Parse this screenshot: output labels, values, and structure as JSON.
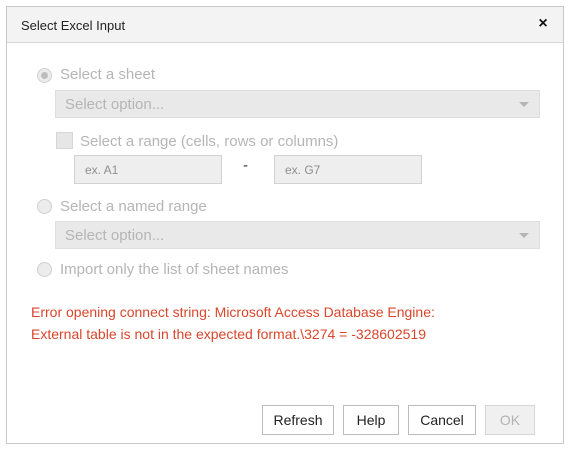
{
  "dialog": {
    "title": "Select Excel Input",
    "close_glyph": "×"
  },
  "options": {
    "sheet": {
      "label": "Select a sheet",
      "checked": true,
      "select_placeholder": "Select option..."
    },
    "range": {
      "label": "Select a range (cells, rows or columns)",
      "from_placeholder": "ex. A1",
      "separator": "-",
      "to_placeholder": "ex. G7"
    },
    "named_range": {
      "label": "Select a named range",
      "checked": false,
      "select_placeholder": "Select option..."
    },
    "sheet_names": {
      "label": "Import only the list of sheet names",
      "checked": false
    }
  },
  "error": {
    "line1": "Error opening connect string: Microsoft Access Database Engine:",
    "line2": "External table is not in the expected format.\\3274 = -328602519"
  },
  "buttons": {
    "refresh": "Refresh",
    "help": "Help",
    "cancel": "Cancel",
    "ok": "OK"
  },
  "colors": {
    "error_text": "#d9462c",
    "disabled_text": "#b5b5b5"
  },
  "icons": {
    "close": "close-icon",
    "dropdown": "chevron-down-icon"
  }
}
